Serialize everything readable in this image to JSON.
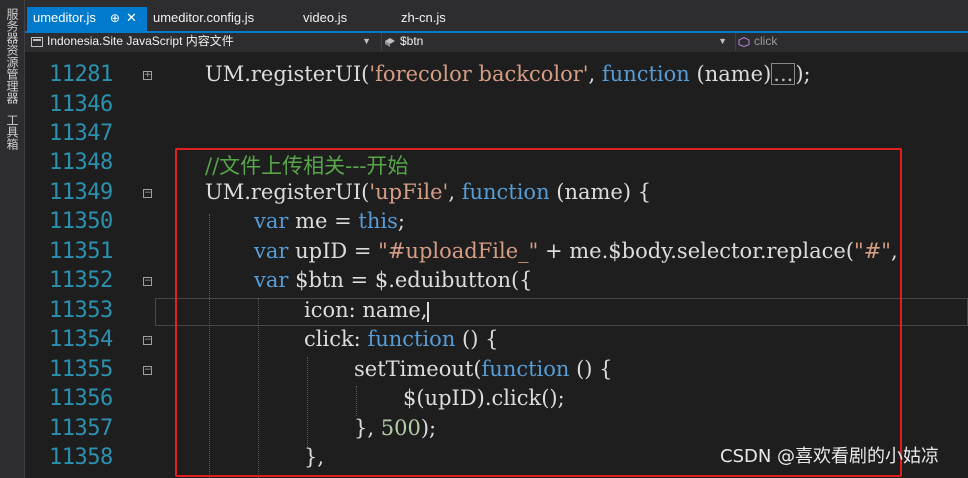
{
  "side_panel": {
    "items": [
      "服务器资源管理器",
      "工具箱"
    ]
  },
  "tabs": [
    {
      "label": "umeditor.js",
      "active": true,
      "pin": "⊕",
      "close": "✕"
    },
    {
      "label": "umeditor.config.js",
      "active": false
    },
    {
      "label": "video.js",
      "active": false
    },
    {
      "label": "zh-cn.js",
      "active": false
    }
  ],
  "navbar": {
    "project": "Indonesia.Site JavaScript 内容文件",
    "object": "$btn",
    "member": "click"
  },
  "editor": {
    "line_numbers": [
      "11281",
      "11346",
      "11347",
      "11348",
      "11349",
      "11350",
      "11351",
      "11352",
      "11353",
      "11354",
      "11355",
      "11356",
      "11357",
      "11358"
    ],
    "lines": {
      "l11281_a": "UM.registerUI(",
      "l11281_str": "'forecolor backcolor'",
      "l11281_b": ", ",
      "l11281_kw": "function",
      "l11281_c": " (name)",
      "l11281_collapsed": "...",
      "l11281_d": ");",
      "l11348_cmt": "//文件上传相关---开始",
      "l11349_a": "UM.registerUI(",
      "l11349_str": "'upFile'",
      "l11349_b": ", ",
      "l11349_kw": "function",
      "l11349_c": " (name) {",
      "l11350_kw1": "var",
      "l11350_a": " me = ",
      "l11350_kw2": "this",
      "l11350_b": ";",
      "l11351_kw": "var",
      "l11351_a": " upID = ",
      "l11351_str": "\"#uploadFile_\"",
      "l11351_b": " + me.$body.selector.replace(",
      "l11351_str2": "\"#\"",
      "l11351_c": ",",
      "l11352_kw": "var",
      "l11352_a": " $btn = $.eduibutton({",
      "l11353_a": "icon: name,",
      "l11354_a": "click: ",
      "l11354_kw": "function",
      "l11354_b": " () {",
      "l11355_a": "setTimeout(",
      "l11355_kw": "function",
      "l11355_b": " () {",
      "l11356_a": "$(upID).click();",
      "l11357_a": "}, ",
      "l11357_num": "500",
      "l11357_b": ");",
      "l11358_a": "},"
    }
  },
  "watermark": "CSDN @喜欢看剧的小姑凉",
  "colors": {
    "accent": "#007acc",
    "keyword": "#569cd6",
    "string": "#d69d85",
    "comment": "#57a64a",
    "line_number": "#2b91af",
    "highlight_box": "#e02020"
  }
}
